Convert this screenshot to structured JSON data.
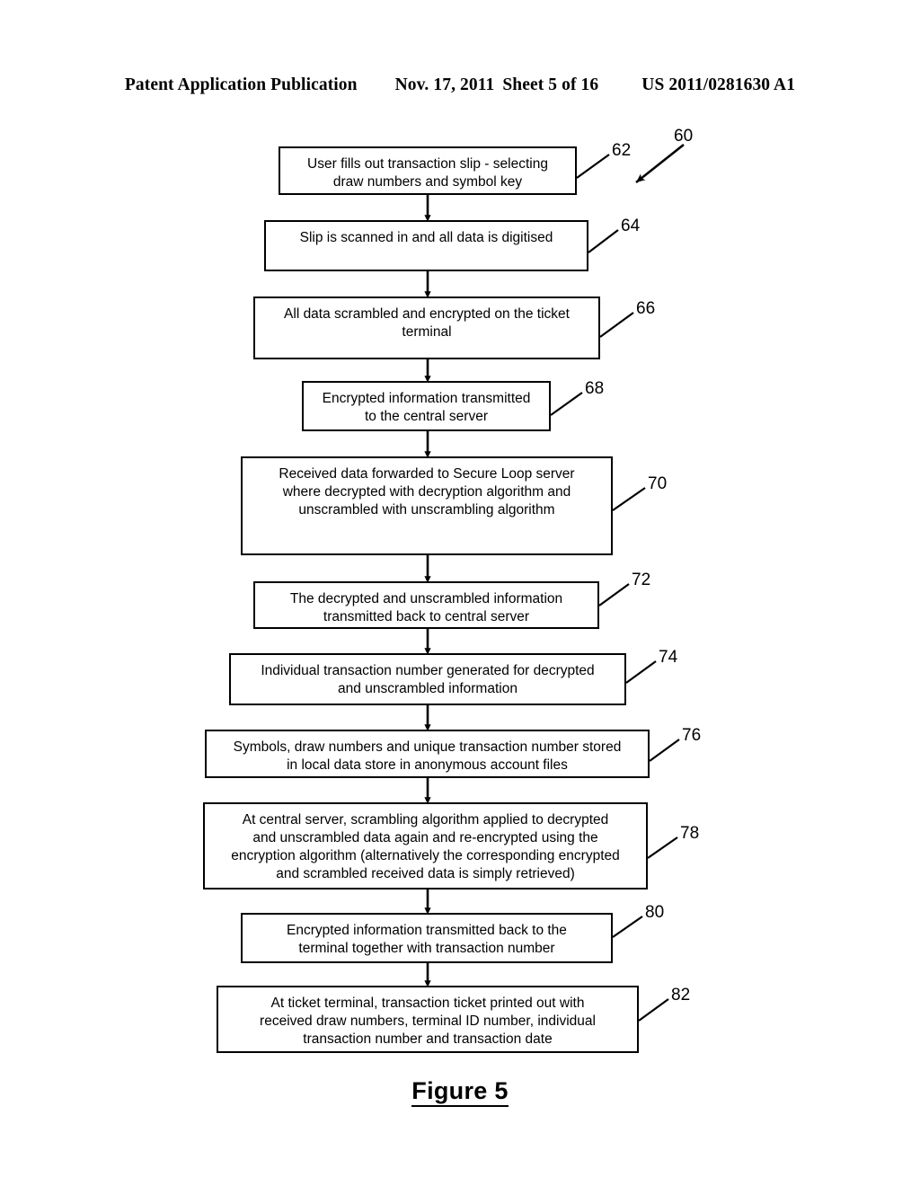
{
  "header": {
    "publication": "Patent Application Publication",
    "date": "Nov. 17, 2011",
    "sheet": "Sheet 5 of 16",
    "patent_number": "US 2011/0281630 A1"
  },
  "figure": {
    "caption": "Figure 5",
    "diagram_ref": "60"
  },
  "chart_data": {
    "type": "flowchart",
    "title": "Figure 5",
    "orientation": "vertical",
    "diagram_reference_numeral": "60",
    "nodes": [
      {
        "ref": "62",
        "text": "User fills out transaction slip - selecting\ndraw numbers and symbol key"
      },
      {
        "ref": "64",
        "text": "Slip is scanned in and all data is digitised"
      },
      {
        "ref": "66",
        "text": "All data scrambled and encrypted on the ticket\nterminal"
      },
      {
        "ref": "68",
        "text": "Encrypted information transmitted\nto the central server"
      },
      {
        "ref": "70",
        "text": "Received data forwarded to Secure Loop server\nwhere decrypted with decryption algorithm and\nunscrambled with unscrambling algorithm"
      },
      {
        "ref": "72",
        "text": "The decrypted and unscrambled information\ntransmitted back to central server"
      },
      {
        "ref": "74",
        "text": "Individual transaction number generated for decrypted\nand unscrambled information"
      },
      {
        "ref": "76",
        "text": "Symbols, draw numbers and unique transaction number stored\nin local data store in anonymous account files"
      },
      {
        "ref": "78",
        "text": "At central server, scrambling algorithm applied to decrypted\nand unscrambled data again and re-encrypted using the\nencryption algorithm (alternatively the corresponding encrypted\nand scrambled received data is simply retrieved)"
      },
      {
        "ref": "80",
        "text": "Encrypted information transmitted back to the\nterminal together with transaction number"
      },
      {
        "ref": "82",
        "text": "At ticket terminal, transaction ticket printed out with\nreceived draw numbers, terminal ID number, individual\ntransaction number and transaction date"
      }
    ],
    "edges": [
      {
        "from": "62",
        "to": "64"
      },
      {
        "from": "64",
        "to": "66"
      },
      {
        "from": "66",
        "to": "68"
      },
      {
        "from": "68",
        "to": "70"
      },
      {
        "from": "70",
        "to": "72"
      },
      {
        "from": "72",
        "to": "74"
      },
      {
        "from": "74",
        "to": "76"
      },
      {
        "from": "76",
        "to": "78"
      },
      {
        "from": "78",
        "to": "80"
      },
      {
        "from": "80",
        "to": "82"
      }
    ],
    "colors": {
      "stroke": "#000000",
      "fill": "#ffffff",
      "background": "#ffffff"
    }
  }
}
